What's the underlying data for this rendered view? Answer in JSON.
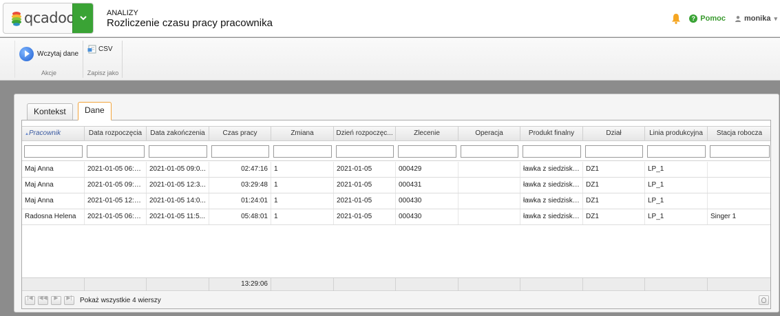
{
  "app": {
    "logo_text": "qcadoo",
    "category": "ANALIZY",
    "title": "Rozliczenie czasu pracy pracownika",
    "help_label": "Pomoc",
    "user_name": "monika"
  },
  "ribbon": {
    "groups": [
      {
        "label": "Akcje",
        "buttons": [
          {
            "label": "Wczytaj dane",
            "icon": "play-icon"
          }
        ]
      },
      {
        "label": "Zapisz jako",
        "buttons": [
          {
            "label": "CSV",
            "icon": "csv-export-icon"
          }
        ]
      }
    ]
  },
  "tabs": [
    {
      "label": "Kontekst",
      "active": false
    },
    {
      "label": "Dane",
      "active": true
    }
  ],
  "grid": {
    "columns": [
      "Pracownik",
      "Data rozpoczęcia",
      "Data zakończenia",
      "Czas pracy",
      "Zmiana",
      "Dzień rozpoczęc...",
      "Zlecenie",
      "Operacja",
      "Produkt finalny",
      "Dział",
      "Linia produkcyjna",
      "Stacja robocza"
    ],
    "rows": [
      [
        "Maj Anna",
        "2021-01-05 06:1...",
        "2021-01-05 09:0...",
        "02:47:16",
        "1",
        "2021-01-05",
        "000429",
        "",
        "ławka z siedziski...",
        "DZ1",
        "LP_1",
        ""
      ],
      [
        "Maj Anna",
        "2021-01-05 09:0...",
        "2021-01-05 12:3...",
        "03:29:48",
        "1",
        "2021-01-05",
        "000431",
        "",
        "ławka z siedziski...",
        "DZ1",
        "LP_1",
        ""
      ],
      [
        "Maj Anna",
        "2021-01-05 12:3...",
        "2021-01-05 14:0...",
        "01:24:01",
        "1",
        "2021-01-05",
        "000430",
        "",
        "ławka z siedziski...",
        "DZ1",
        "LP_1",
        ""
      ],
      [
        "Radosna Helena",
        "2021-01-05 06:1...",
        "2021-01-05 11:5...",
        "05:48:01",
        "1",
        "2021-01-05",
        "000430",
        "",
        "ławka z siedziski...",
        "DZ1",
        "LP_1",
        "Singer 1"
      ]
    ],
    "sort_column": "Pracownik",
    "sort_direction": "ascending",
    "summary": {
      "Czas pracy": "13:29:06"
    },
    "footer_text": "Pokaż wszystkie 4 wierszy"
  },
  "colors": {
    "accent_green": "#3aa335",
    "active_tab_border": "#f2a33a",
    "bell": "#f5a623",
    "backdrop": "#8c8c8c"
  }
}
